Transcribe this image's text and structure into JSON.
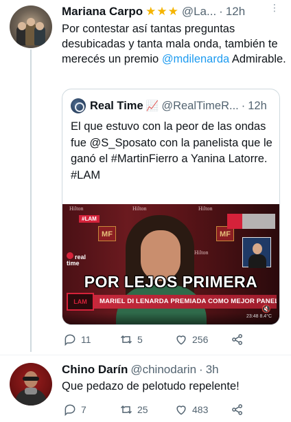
{
  "tweets": [
    {
      "author_name": "Mariana Carpo",
      "badge": "★★★",
      "handle": "@La...",
      "separator": "·",
      "time": "12h",
      "text_parts": {
        "pre": "Por contestar así tantas preguntas desubicadas y tanta mala onda, también te merecés un premio ",
        "mention": "@mdilenarda",
        "post": " Admirable."
      },
      "quote": {
        "author_name": "Real Time",
        "author_emoji": "📈",
        "handle": "@RealTimeR...",
        "separator": "·",
        "time": "12h",
        "text": "El que estuvo con la peor de las ondas fue @S_Sposato con la panelista que le ganó el #MartinFierro a Yanina Latorre. #LAM",
        "media": {
          "headline": "POR LEJOS PRIMERA",
          "lower_third": "MARIEL DI LENARDA PREMIADA COMO MEJOR PANELISTA",
          "lower_third_logo": "LAM",
          "show_tag": "#LAM",
          "channel_bug": "real time",
          "sponsor_logos": [
            "Hilton",
            "Hilton",
            "Hilton",
            "Hilton"
          ],
          "award_badge": "MF",
          "mute_icon": "speaker-muted-icon",
          "clock": "23:48  8.4°C"
        }
      },
      "actions": {
        "reply_count": "11",
        "retweet_count": "5",
        "like_count": "256"
      }
    },
    {
      "author_name": "Chino Darín",
      "handle": "@chinodarin",
      "separator": "·",
      "time": "3h",
      "text": "Que pedazo de pelotudo repelente!",
      "actions": {
        "reply_count": "7",
        "retweet_count": "25",
        "like_count": "483"
      }
    }
  ],
  "colors": {
    "link": "#1d9bf0",
    "secondary_text": "#536471",
    "star": "#f5b400"
  }
}
